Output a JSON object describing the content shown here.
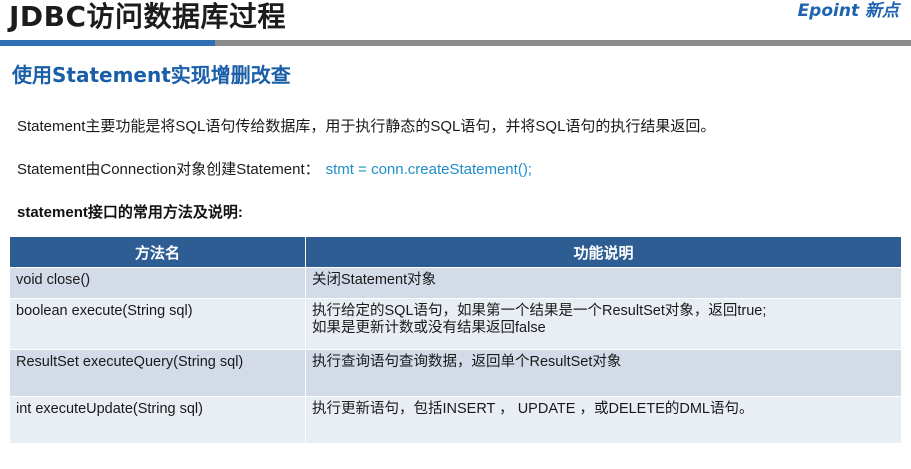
{
  "slide": {
    "title": "JDBC访问数据库过程",
    "logo": "Epoint 新点"
  },
  "section": {
    "heading": "使用Statement实现增删改查"
  },
  "paragraphs": {
    "p1": "Statement主要功能是将SQL语句传给数据库，用于执行静态的SQL语句，并将SQL语句的执行结果返回。",
    "p2_text": "Statement由Connection对象创建Statement：",
    "p2_code": "stmt = conn.createStatement();"
  },
  "table": {
    "caption": "statement接口的常用方法及说明:",
    "headers": [
      "方法名",
      "功能说明"
    ],
    "rows": [
      {
        "method": "void close()",
        "desc": "关闭Statement对象"
      },
      {
        "method": "boolean execute(String sql)",
        "desc": "执行给定的SQL语句，如果第一个结果是一个ResultSet对象，返回true;\n如果是更新计数或没有结果返回false"
      },
      {
        "method": "ResultSet executeQuery(String sql)",
        "desc": "执行查询语句查询数据，返回单个ResultSet对象"
      },
      {
        "method": "int executeUpdate(String sql)",
        "desc": "执行更新语句，包括INSERT ， UPDATE ，或DELETE的DML语句。"
      }
    ]
  },
  "colors": {
    "accent_blue": "#1a5ea8",
    "header_bg": "#2e5d94",
    "code_color": "#1f8ec9",
    "row_dark": "#d3dbe9",
    "row_light": "#e9edf4"
  }
}
